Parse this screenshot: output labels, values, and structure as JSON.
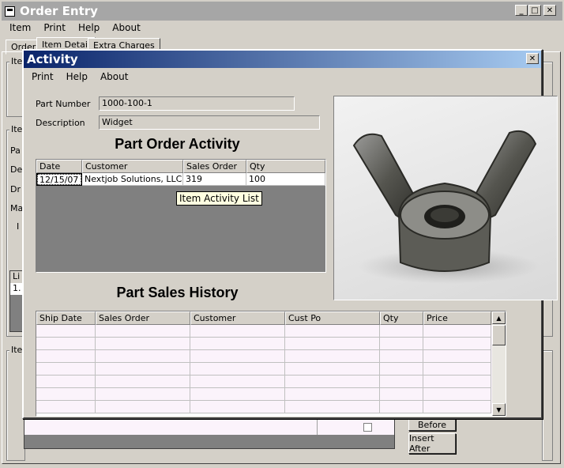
{
  "app": {
    "title": "Order Entry",
    "menu": [
      "Item",
      "Print",
      "Help",
      "About"
    ],
    "tabs": [
      "Order",
      "Item Detail",
      "Extra Charges"
    ],
    "bg_labels": {
      "item_group_1": "Ite",
      "item_group_2": "Ite",
      "item_group_3": "Ite",
      "row_pa": "Pa",
      "row_de": "De",
      "row_dr": "Dr",
      "row_ma": "Ma",
      "row_i": "I",
      "list_head": "Li",
      "list_val": "1."
    },
    "buttons": {
      "before": "Before",
      "insert_after": "Insert After"
    }
  },
  "activity": {
    "title": "Activity",
    "menu": [
      "Print",
      "Help",
      "About"
    ],
    "part_number_label": "Part Number",
    "part_number": "1000-100-1",
    "description_label": "Description",
    "description": "Widget",
    "order_heading": "Part Order Activity",
    "order_columns": [
      "Date",
      "Customer",
      "Sales Order",
      "Qty"
    ],
    "order_rows": [
      [
        "12/15/07",
        "Nextjob Solutions, LLC",
        "319",
        "100"
      ]
    ],
    "tooltip": "Item Activity List",
    "sales_heading": "Part Sales History",
    "sales_columns": [
      "Ship Date",
      "Sales Order",
      "Customer",
      "Cust Po",
      "Qty",
      "Price"
    ],
    "image_icon": "wing-nut-photo"
  },
  "colors": {
    "title_active": "#0a246a",
    "grid_empty": "#808080",
    "row_pink": "#fbf3fb"
  }
}
